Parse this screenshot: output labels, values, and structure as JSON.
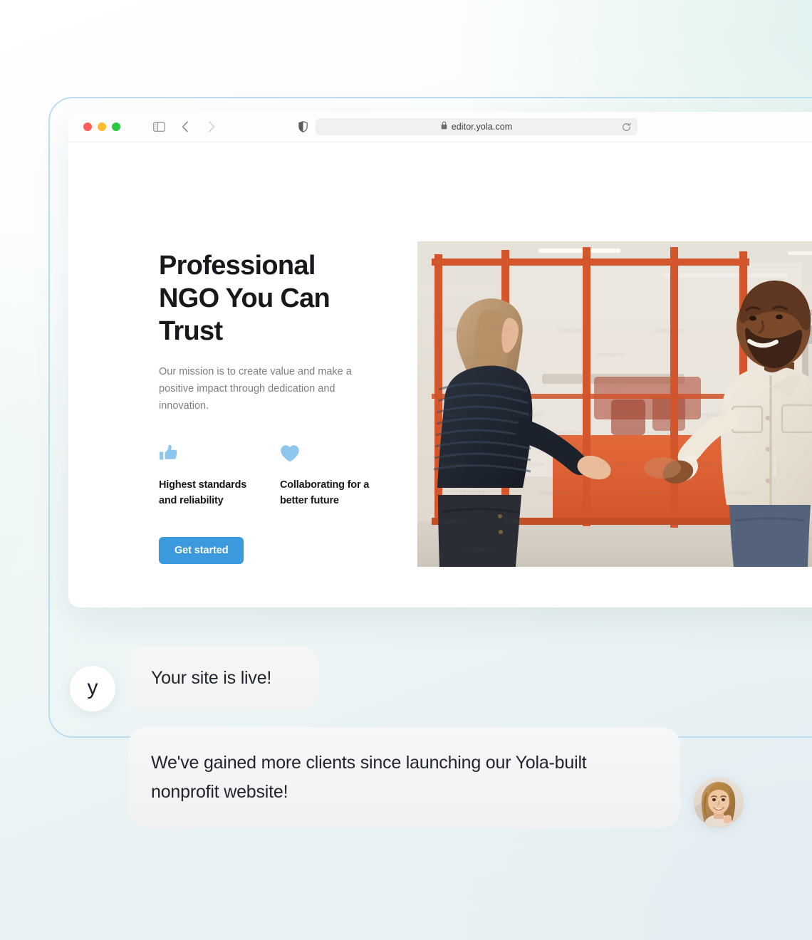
{
  "browser": {
    "traffic_lights": [
      "close",
      "minimize",
      "maximize"
    ],
    "sidebar_toggle": "sidebar-toggle-icon",
    "back": "back-chevron-icon",
    "forward": "forward-chevron-icon",
    "shield": "shield-icon",
    "lock": "lock-icon",
    "url": "editor.yola.com",
    "reload": "reload-icon"
  },
  "site": {
    "hero": {
      "heading": "Professional NGO You Can Trust",
      "paragraph": "Our mission is to create value and make a positive impact through dedication and innovation.",
      "cta_label": "Get started",
      "cta_color": "#3b9ade",
      "features": [
        {
          "icon": "thumbs-up-icon",
          "icon_color": "#8ec5ec",
          "label": "Highest standards and reliability"
        },
        {
          "icon": "heart-icon",
          "icon_color": "#8ec5ec",
          "label": "Collaborating for a better future"
        }
      ],
      "photo_alt": "two-people-shaking-hands-in-office"
    }
  },
  "chat": {
    "brand_avatar_glyph": "y",
    "messages": [
      {
        "id": "status",
        "text": "Your site is live!"
      },
      {
        "id": "testimonial",
        "text": "We've gained more clients since launching our Yola-built nonprofit website!"
      }
    ],
    "client_avatar_alt": "smiling-woman-portrait"
  },
  "theme": {
    "background_mint": "#dff1ee",
    "background_blue": "#e3edf2",
    "frame_border": "#bcdcef",
    "bubble_bg": "#f3f5f5",
    "text_dark": "#17181c",
    "text_muted": "#7b7f86"
  }
}
